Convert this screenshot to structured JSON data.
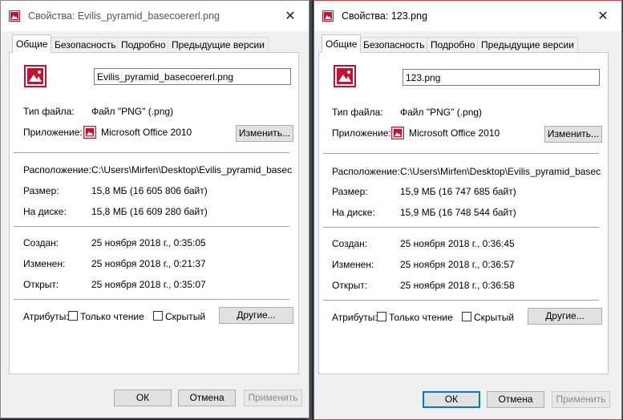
{
  "dialogs": [
    {
      "title": "Свойства: Evilis_pyramid_basecoererl.png",
      "tabs": [
        "Общие",
        "Безопасность",
        "Подробно",
        "Предыдущие версии"
      ],
      "filename": "Evilis_pyramid_basecoererl.png",
      "file_type_label": "Тип файла:",
      "file_type_value": "Файл \"PNG\" (.png)",
      "app_label": "Приложение:",
      "app_value": "Microsoft Office 2010",
      "change_button": "Изменить...",
      "location_label": "Расположение:",
      "location_value": "C:\\Users\\Mirfen\\Desktop\\Evilis_pyramid_basecoererl",
      "size_label": "Размер:",
      "size_value": "15,8 МБ (16 605 806 байт)",
      "disk_label": "На диске:",
      "disk_value": "15,8 МБ (16 609 280 байт)",
      "created_label": "Создан:",
      "created_value": "25 ноября 2018 г., 0:35:05",
      "modified_label": "Изменен:",
      "modified_value": "25 ноября 2018 г., 0:21:37",
      "opened_label": "Открыт:",
      "opened_value": "25 ноября 2018 г., 0:35:07",
      "attributes_label": "Атрибуты:",
      "readonly_label": "Только чтение",
      "hidden_label": "Скрытый",
      "other_button": "Другие...",
      "ok_button": "ОК",
      "cancel_button": "Отмена",
      "apply_button": "Применить"
    },
    {
      "title": "Свойства: 123.png",
      "tabs": [
        "Общие",
        "Безопасность",
        "Подробно",
        "Предыдущие версии"
      ],
      "filename": "123.png",
      "file_type_label": "Тип файла:",
      "file_type_value": "Файл \"PNG\" (.png)",
      "app_label": "Приложение:",
      "app_value": "Microsoft Office 2010",
      "change_button": "Изменить...",
      "location_label": "Расположение:",
      "location_value": "C:\\Users\\Mirfen\\Desktop\\Evilis_pyramid_basecoererl",
      "size_label": "Размер:",
      "size_value": "15,9 МБ (16 747 685 байт)",
      "disk_label": "На диске:",
      "disk_value": "15,9 МБ (16 748 544 байт)",
      "created_label": "Создан:",
      "created_value": "25 ноября 2018 г., 0:36:45",
      "modified_label": "Изменен:",
      "modified_value": "25 ноября 2018 г., 0:36:57",
      "opened_label": "Открыт:",
      "opened_value": "25 ноября 2018 г., 0:36:58",
      "attributes_label": "Атрибуты:",
      "readonly_label": "Только чтение",
      "hidden_label": "Скрытый",
      "other_button": "Другие...",
      "ok_button": "ОК",
      "cancel_button": "Отмена",
      "apply_button": "Применить"
    }
  ],
  "icons": {
    "file": "image-file-icon",
    "app": "office-picture-manager-icon",
    "close": "close-icon"
  },
  "colors": {
    "dialog_bg": "#f0f0f0",
    "panel_bg": "#ffffff",
    "active_border": "#e23b3b",
    "primary_button_border": "#0078d7",
    "icon_red": "#c8102e"
  }
}
